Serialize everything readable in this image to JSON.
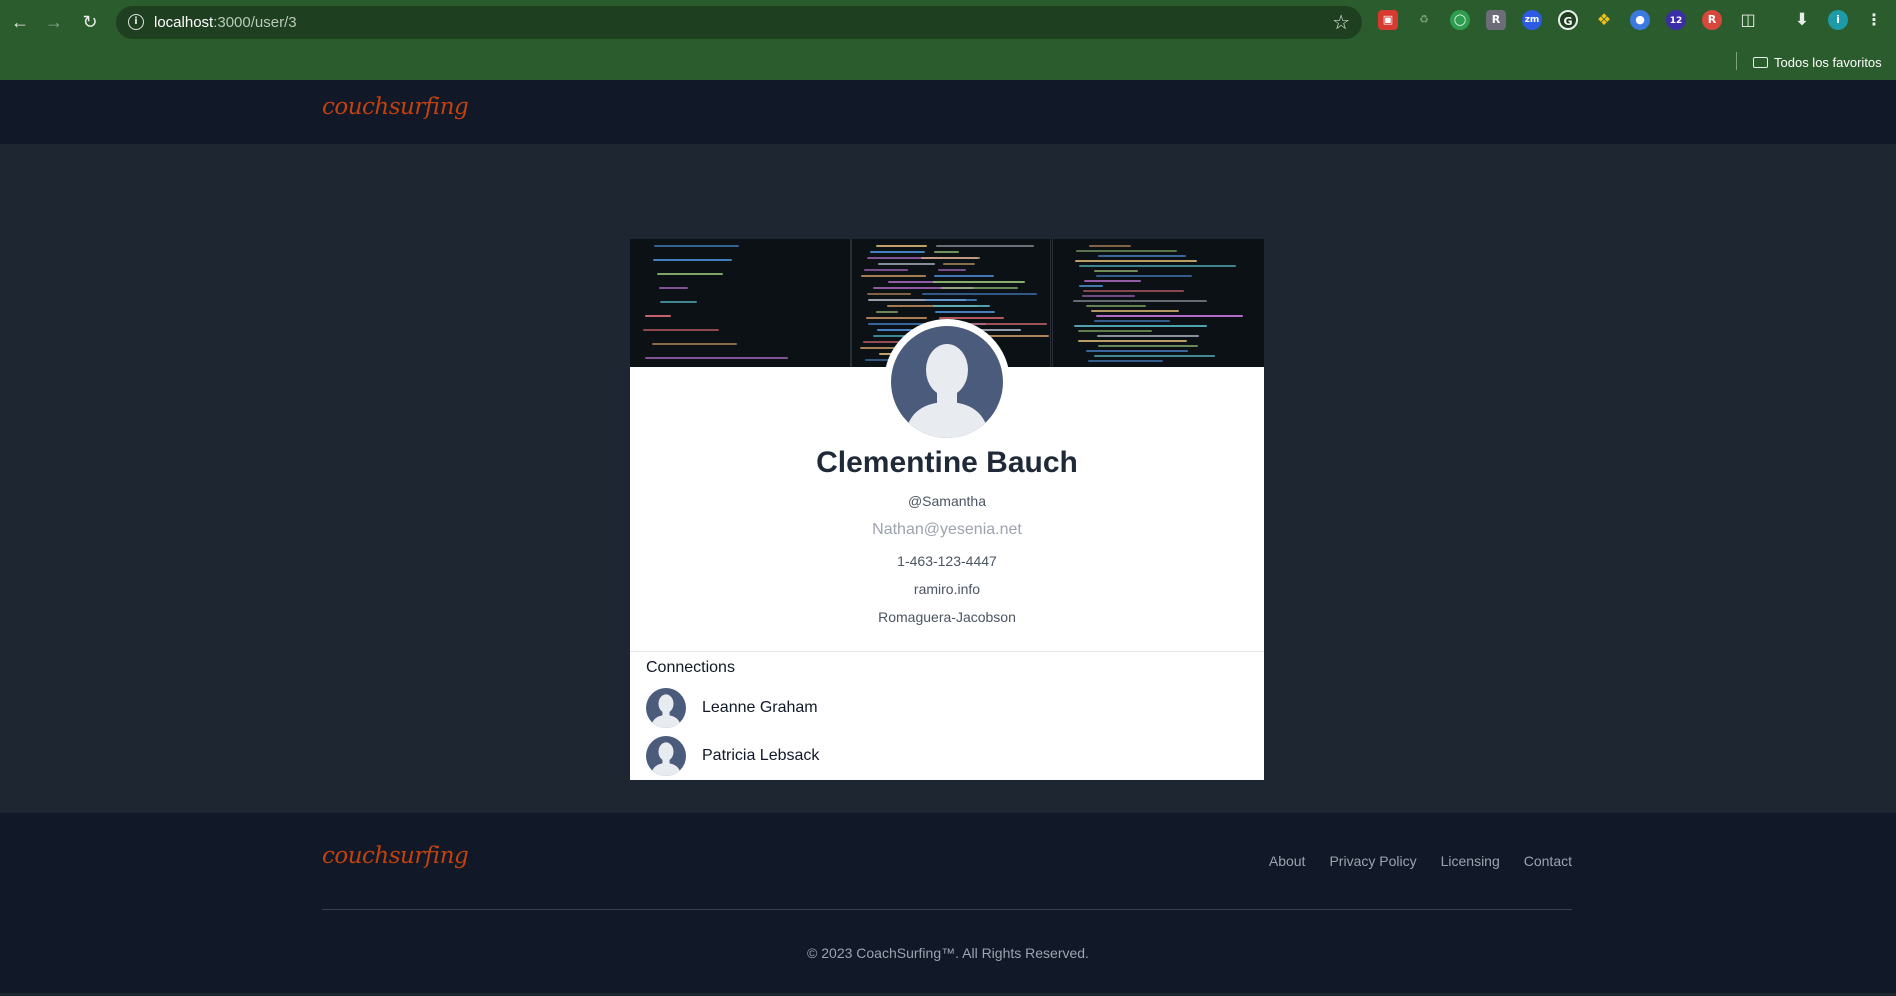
{
  "browser": {
    "url_host": "localhost",
    "url_path": ":3000/user/3",
    "bookmarks_folder": "Todos los favoritos",
    "extension_badge": "12",
    "profile_initial": "i"
  },
  "header": {
    "logo": "couchsurfing"
  },
  "profile": {
    "name": "Clementine Bauch",
    "username": "@Samantha",
    "email": "Nathan@yesenia.net",
    "phone": "1-463-123-4447",
    "website": "ramiro.info",
    "company": "Romaguera-Jacobson"
  },
  "connections": {
    "title": "Connections",
    "items": [
      {
        "name": "Leanne Graham"
      },
      {
        "name": "Patricia Lebsack"
      }
    ]
  },
  "footer": {
    "logo": "couchsurfing",
    "links": [
      "About",
      "Privacy Policy",
      "Licensing",
      "Contact"
    ],
    "copyright": "© 2023 CoachSurfing™. All Rights Reserved."
  },
  "colors": {
    "brand": "#c2410c",
    "header_bg": "#111827",
    "page_bg": "#1e2632",
    "avatar_bg": "#4b5b7c",
    "chrome_bg": "#2b5c2d"
  }
}
